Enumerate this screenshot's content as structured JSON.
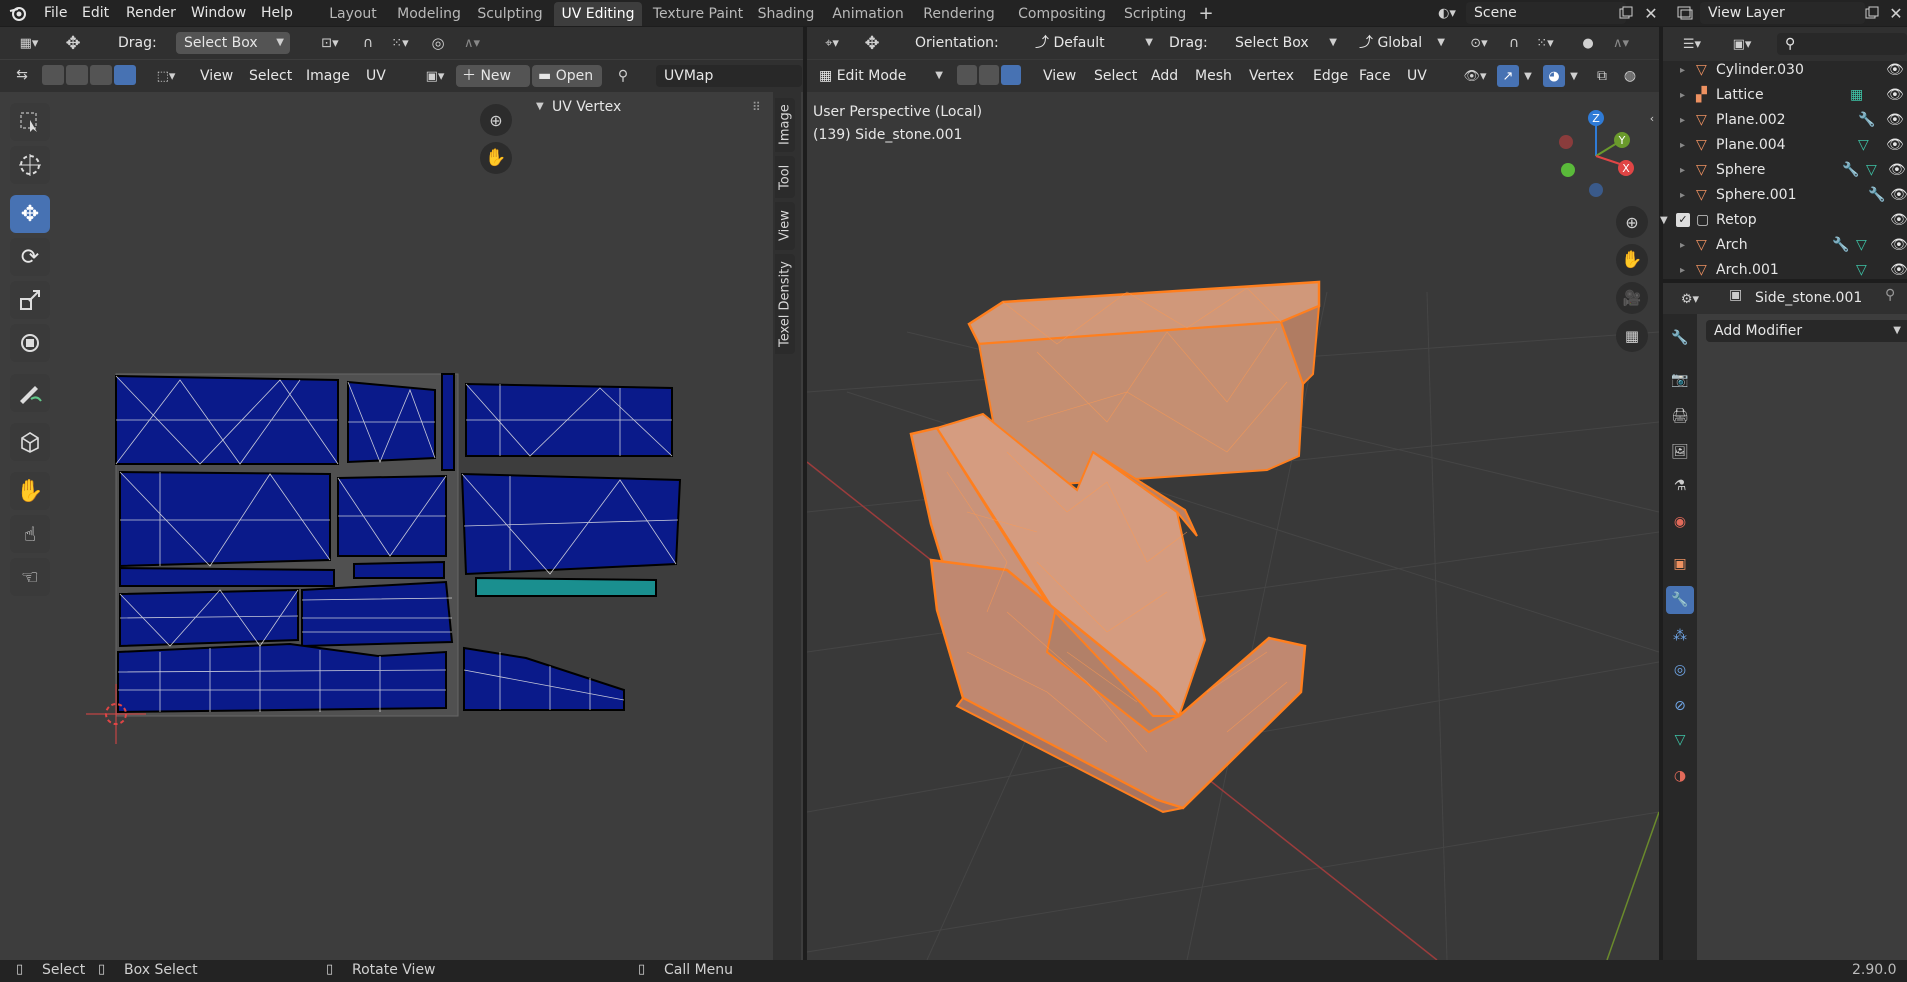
{
  "colors": {
    "accent": "#4772b3",
    "selection_orange": "#ff7f1e",
    "uv_island_blue": "#0a1a8a",
    "object_orange": "#ed9161"
  },
  "topbar": {
    "menus": [
      "File",
      "Edit",
      "Render",
      "Window",
      "Help"
    ],
    "workspace_tabs": [
      "Layout",
      "Modeling",
      "Sculpting",
      "UV Editing",
      "Texture Paint",
      "Shading",
      "Animation",
      "Rendering",
      "Compositing",
      "Scripting"
    ],
    "active_tab": "UV Editing",
    "scene_name": "Scene",
    "view_layer": "View Layer"
  },
  "uv_editor": {
    "drag_label": "Drag:",
    "drag_value": "Select Box",
    "menus": [
      "View",
      "Select",
      "Image",
      "UV"
    ],
    "new_label": "New",
    "open_label": "Open",
    "uvmap_value": "UVMap",
    "panel_title": "UV Vertex",
    "side_tabs": [
      "Image",
      "Tool",
      "View",
      "Texel Density"
    ]
  },
  "viewport": {
    "orientation_label": "Orientation:",
    "orientation_value": "Default",
    "drag_label": "Drag:",
    "drag_value": "Select Box",
    "transform_space": "Global",
    "mode": "Edit Mode",
    "menus": [
      "View",
      "Select",
      "Add",
      "Mesh",
      "Vertex",
      "Edge",
      "Face",
      "UV"
    ],
    "perspective_text": "User Perspective (Local)",
    "object_text": "(139) Side_stone.001",
    "gizmo": {
      "z": "Z",
      "y": "Y",
      "x": "X"
    }
  },
  "outliner": {
    "rows": [
      {
        "name": "Cylinder.030",
        "type": "mesh"
      },
      {
        "name": "Lattice",
        "type": "lattice"
      },
      {
        "name": "Plane.002",
        "type": "mesh"
      },
      {
        "name": "Plane.004",
        "type": "mesh"
      },
      {
        "name": "Sphere",
        "type": "mesh"
      },
      {
        "name": "Sphere.001",
        "type": "mesh"
      },
      {
        "name": "Retop",
        "type": "collection"
      },
      {
        "name": "Arch",
        "type": "mesh"
      },
      {
        "name": "Arch.001",
        "type": "mesh"
      }
    ]
  },
  "properties": {
    "object_name": "Side_stone.001",
    "add_modifier": "Add Modifier"
  },
  "statusbar": {
    "select": "Select",
    "box_select": "Box Select",
    "rotate_view": "Rotate View",
    "call_menu": "Call Menu",
    "version": "2.90.0"
  }
}
